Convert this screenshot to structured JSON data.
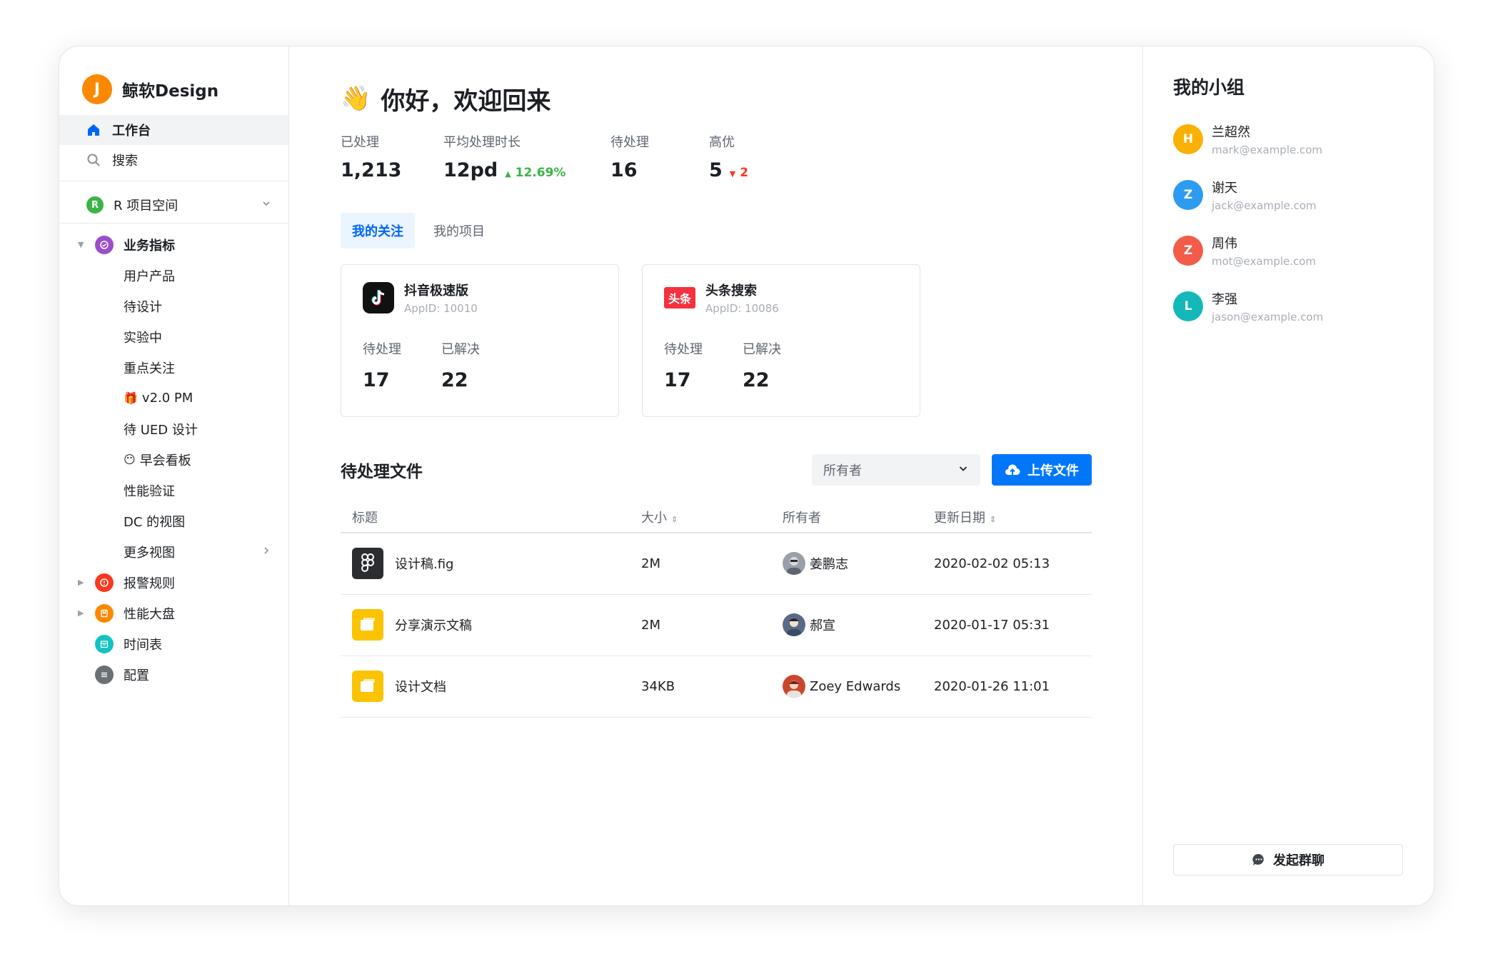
{
  "brand": {
    "initial": "J",
    "name": "鲸软Design",
    "color": "#fc8800"
  },
  "nav": {
    "workbench": "工作台",
    "search": "搜索"
  },
  "space": {
    "initial": "R",
    "label": "R 项目空间",
    "color": "#3bb346"
  },
  "tree": {
    "metrics": {
      "label": "业务指标",
      "color": "#9b4dcb",
      "icon": "check-circle-icon"
    },
    "sub": [
      "用户产品",
      "待设计",
      "实验中",
      "重点关注",
      "v2.0 PM",
      "待 UED 设计",
      "早会看板",
      "性能验证",
      "DC 的视图",
      "更多视图"
    ],
    "sub_emoji": {
      "v2": "🎁",
      "standup": "😶"
    },
    "alerts": {
      "label": "报警规则",
      "color": "#f93920",
      "icon": "alert-icon"
    },
    "dashboard": {
      "label": "性能大盘",
      "color": "#fc8800",
      "icon": "bookmark-icon"
    },
    "schedule": {
      "label": "时间表",
      "color": "#13c2c2",
      "icon": "calendar-icon"
    },
    "config": {
      "label": "配置",
      "color": "#6b7075",
      "icon": "sliders-icon"
    }
  },
  "main": {
    "greeting": "你好，欢迎回来",
    "greeting_emoji": "👋",
    "stats": [
      {
        "label": "已处理",
        "value": "1,213"
      },
      {
        "label": "平均处理时长",
        "value": "12pd",
        "delta": "12.69%",
        "delta_dir": "up"
      },
      {
        "label": "待处理",
        "value": "16"
      },
      {
        "label": "高优",
        "value": "5",
        "delta": "2",
        "delta_dir": "down"
      }
    ],
    "tabs": [
      "我的关注",
      "我的项目"
    ],
    "cards": [
      {
        "name": "抖音极速版",
        "appid": "AppID: 10010",
        "pending_label": "待处理",
        "pending": "17",
        "resolved_label": "已解决",
        "resolved": "22",
        "logo": "douyin-logo-icon"
      },
      {
        "name": "头条搜索",
        "appid": "AppID: 10086",
        "pending_label": "待处理",
        "pending": "17",
        "resolved_label": "已解决",
        "resolved": "22",
        "logo": "toutiao-logo-icon",
        "logo_text": "头条"
      }
    ],
    "files": {
      "title": "待处理文件",
      "owner_placeholder": "所有者",
      "upload": "上传文件",
      "columns": [
        "标题",
        "大小",
        "所有者",
        "更新日期"
      ],
      "rows": [
        {
          "title": "设计稿.fig",
          "size": "2M",
          "owner": "姜鹏志",
          "date": "2020-02-02 05:13",
          "icon": "figma-file-icon"
        },
        {
          "title": "分享演示文稿",
          "size": "2M",
          "owner": "郝宣",
          "date": "2020-01-17 05:31",
          "icon": "slides-file-icon"
        },
        {
          "title": "设计文档",
          "size": "34KB",
          "owner": "Zoey Edwards",
          "date": "2020-01-26 11:01",
          "icon": "doc-file-icon"
        }
      ]
    }
  },
  "group": {
    "title": "我的小组",
    "members": [
      {
        "initial": "H",
        "name": "兰超然",
        "email": "mark@example.com",
        "color": "#fab005"
      },
      {
        "initial": "Z",
        "name": "谢天",
        "email": "jack@example.com",
        "color": "#2d9cf0"
      },
      {
        "initial": "Z",
        "name": "周伟",
        "email": "mot@example.com",
        "color": "#f25c48"
      },
      {
        "initial": "L",
        "name": "李强",
        "email": "jason@example.com",
        "color": "#14b8b8"
      }
    ],
    "chat_button": "发起群聊"
  },
  "colors": {
    "primary": "#0077fa",
    "up": "#3bb346",
    "down": "#f93920"
  }
}
